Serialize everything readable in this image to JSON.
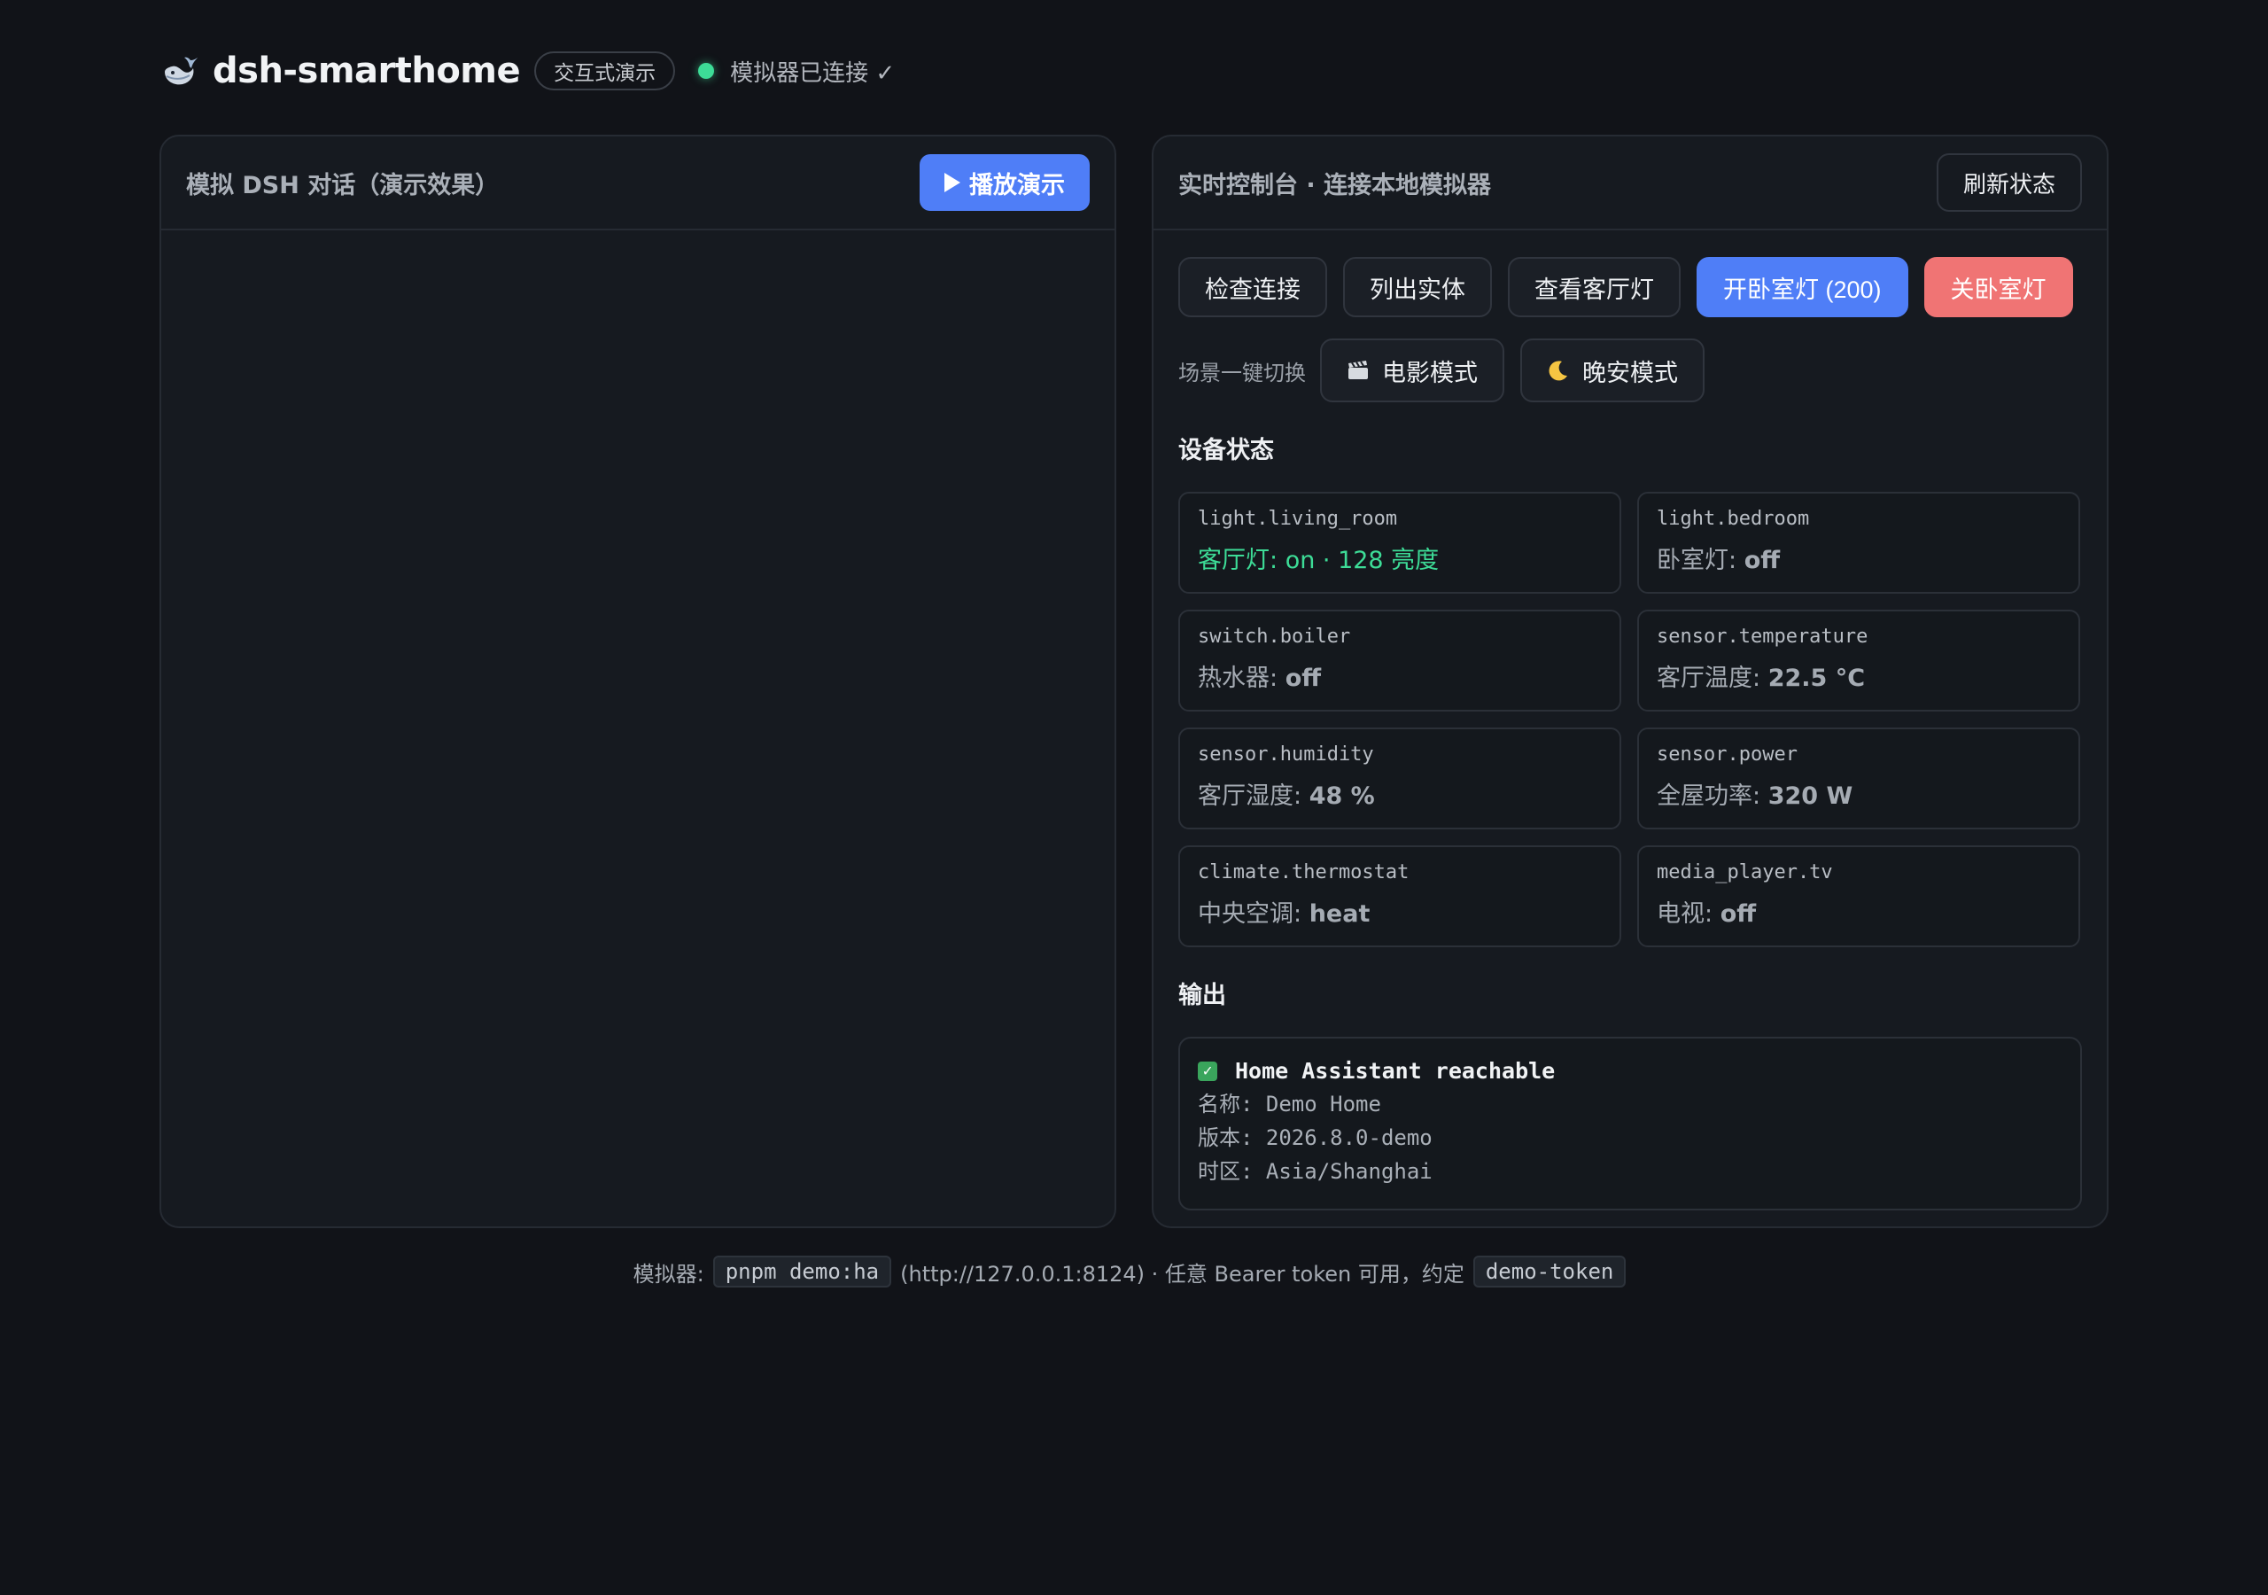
{
  "header": {
    "logo_icon": "whale-icon",
    "title": "dsh-smarthome",
    "mode_pill": "交互式演示",
    "status_text": "模拟器已连接 ✓",
    "status_color": "#3ddc97"
  },
  "left_panel": {
    "title": "模拟 DSH 对话（演示效果）",
    "play_button": "播放演示"
  },
  "right_panel": {
    "title": "实时控制台 · 连接本地模拟器",
    "refresh_button": "刷新状态",
    "actions": {
      "check": "检查连接",
      "list": "列出实体",
      "view_living": "查看客厅灯",
      "bedroom_on": "开卧室灯 (200)",
      "bedroom_off": "关卧室灯"
    },
    "scene_label": "场景一键切换",
    "scenes": {
      "movie": "电影模式",
      "night": "晚安模式"
    },
    "devices_title": "设备状态",
    "devices": [
      {
        "id": "light.living_room",
        "label": "客厅灯: ",
        "value": "on · 128 亮度"
      },
      {
        "id": "light.bedroom",
        "label": "卧室灯: ",
        "value": "off"
      },
      {
        "id": "switch.boiler",
        "label": "热水器: ",
        "value": "off"
      },
      {
        "id": "sensor.temperature",
        "label": "客厅温度: ",
        "value": "22.5 °C"
      },
      {
        "id": "sensor.humidity",
        "label": "客厅湿度: ",
        "value": "48 %"
      },
      {
        "id": "sensor.power",
        "label": "全屋功率: ",
        "value": "320 W"
      },
      {
        "id": "climate.thermostat",
        "label": "中央空调: ",
        "value": "heat"
      },
      {
        "id": "media_player.tv",
        "label": "电视: ",
        "value": "off"
      }
    ],
    "output_title": "输出",
    "output": {
      "headline": "Home Assistant reachable",
      "lines": [
        "名称: Demo Home",
        "版本: 2026.8.0-demo",
        "时区: Asia/Shanghai"
      ]
    }
  },
  "footer": {
    "prefix": "模拟器:",
    "cmd": "pnpm demo:ha",
    "middle": "(http://127.0.0.1:8124) · 任意 Bearer token 可用，约定",
    "token": "demo-token"
  },
  "colors": {
    "accent_blue": "#4f7ef7",
    "danger_red": "#f07474",
    "on_green": "#3ddc97"
  }
}
